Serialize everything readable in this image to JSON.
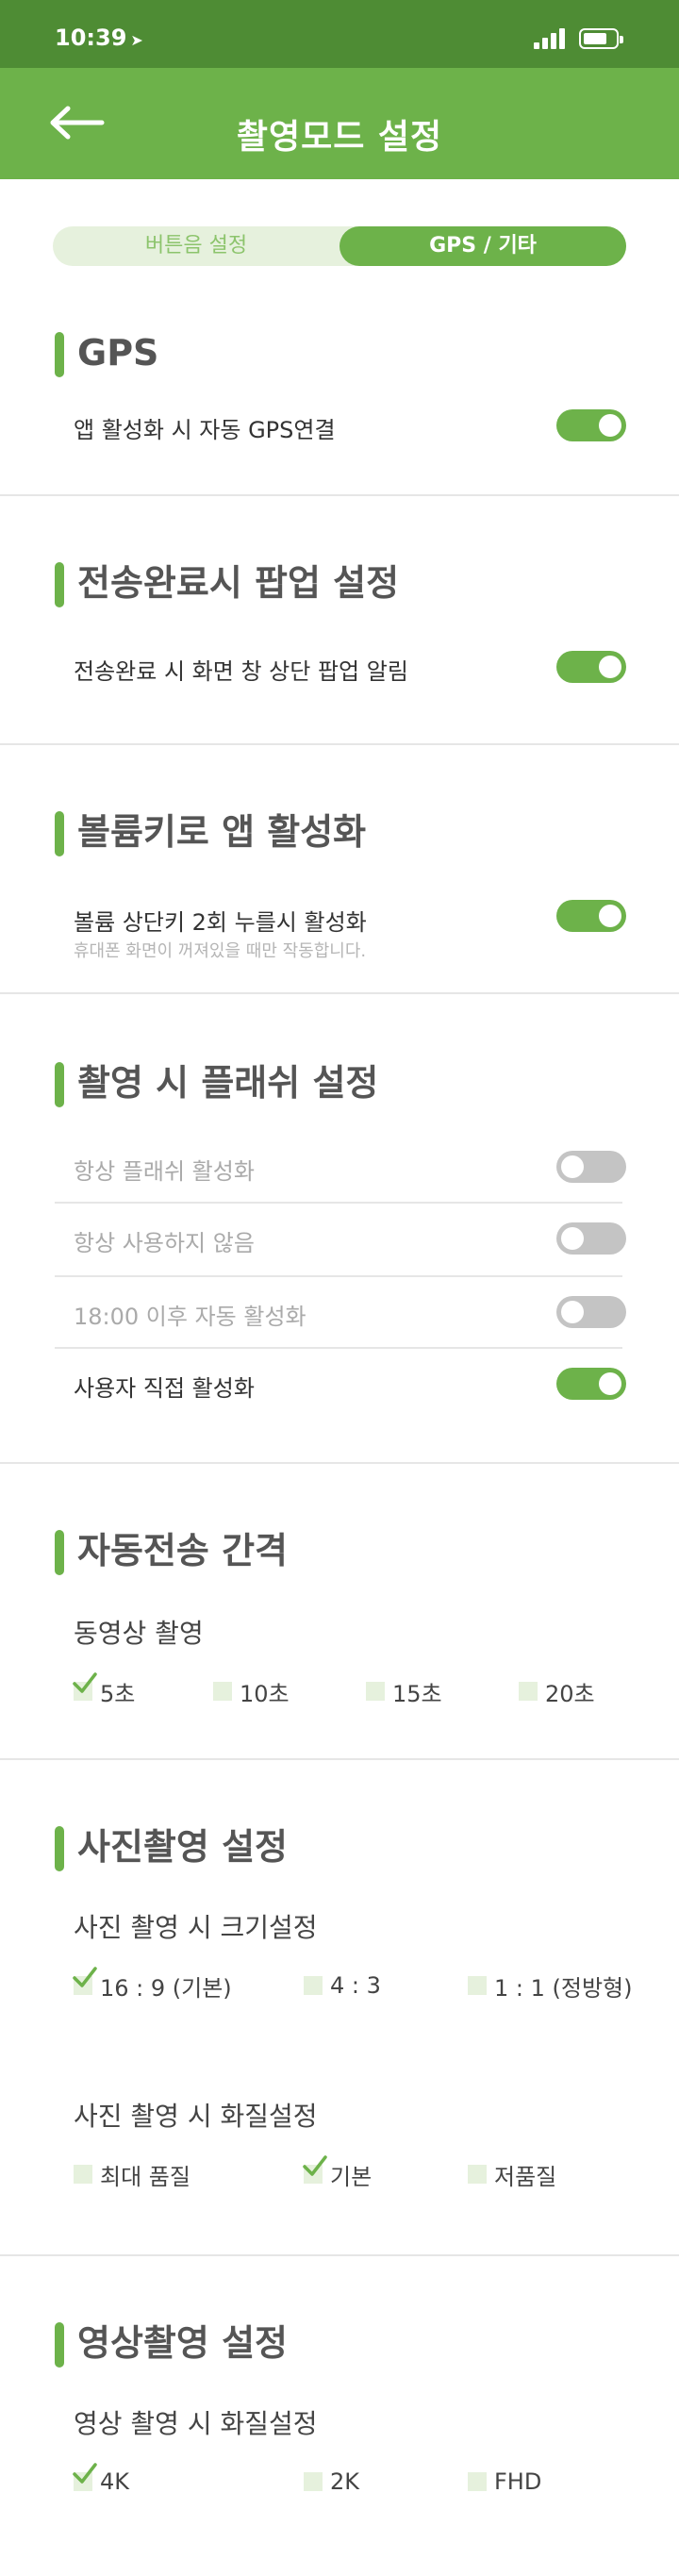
{
  "status_bar": {
    "time": "10:39",
    "location_icon": "location-arrow-icon"
  },
  "header": {
    "title": "촬영모드 설정",
    "back_icon": "back-arrow-icon"
  },
  "tabs": [
    {
      "label": "버튼음 설정",
      "selected": false
    },
    {
      "label": "GPS / 기타",
      "selected": true
    }
  ],
  "colors": {
    "primary": "#6db24a",
    "status_bar": "#4e8c34",
    "toggle_off": "#c4c4c4",
    "checkbox_bg": "#e6f1dd"
  },
  "gps": {
    "title": "GPS",
    "row": {
      "label": "앱 활성화 시 자동 GPS연결",
      "on": true
    }
  },
  "popup": {
    "title": "전송완료시 팝업 설정",
    "row": {
      "label": "전송완료 시 화면 창 상단 팝업 알림",
      "on": true
    }
  },
  "volume": {
    "title": "볼륨키로 앱 활성화",
    "row": {
      "label": "볼륨 상단키 2회 누를시 활성화",
      "sub": "휴대폰 화면이 꺼져있을 때만 작동합니다.",
      "on": true
    }
  },
  "flash": {
    "title": "촬영 시 플래쉬 설정",
    "rows": [
      {
        "label": "항상 플래쉬 활성화",
        "on": false
      },
      {
        "label": "항상 사용하지 않음",
        "on": false
      },
      {
        "label": "18:00 이후 자동 활성화",
        "on": false
      },
      {
        "label": "사용자 직접 활성화",
        "on": true
      }
    ]
  },
  "auto_send": {
    "title": "자동전송 간격",
    "subhead": "동영상 촬영",
    "options": [
      {
        "label": "5초",
        "checked": true
      },
      {
        "label": "10초",
        "checked": false
      },
      {
        "label": "15초",
        "checked": false
      },
      {
        "label": "20초",
        "checked": false
      }
    ]
  },
  "photo": {
    "title": "사진촬영 설정",
    "size_subhead": "사진 촬영 시 크기설정",
    "size_options": [
      {
        "label": "16 : 9 (기본)",
        "checked": true
      },
      {
        "label": "4 : 3",
        "checked": false
      },
      {
        "label": "1 : 1 (정방형)",
        "checked": false
      }
    ],
    "quality_subhead": "사진 촬영 시 화질설정",
    "quality_options": [
      {
        "label": "최대 품질",
        "checked": false
      },
      {
        "label": "기본",
        "checked": true
      },
      {
        "label": "저품질",
        "checked": false
      }
    ]
  },
  "video": {
    "title": "영상촬영 설정",
    "subhead": "영상 촬영 시 화질설정",
    "options": [
      {
        "label": "4K",
        "checked": true
      },
      {
        "label": "2K",
        "checked": false
      },
      {
        "label": "FHD",
        "checked": false
      }
    ]
  }
}
